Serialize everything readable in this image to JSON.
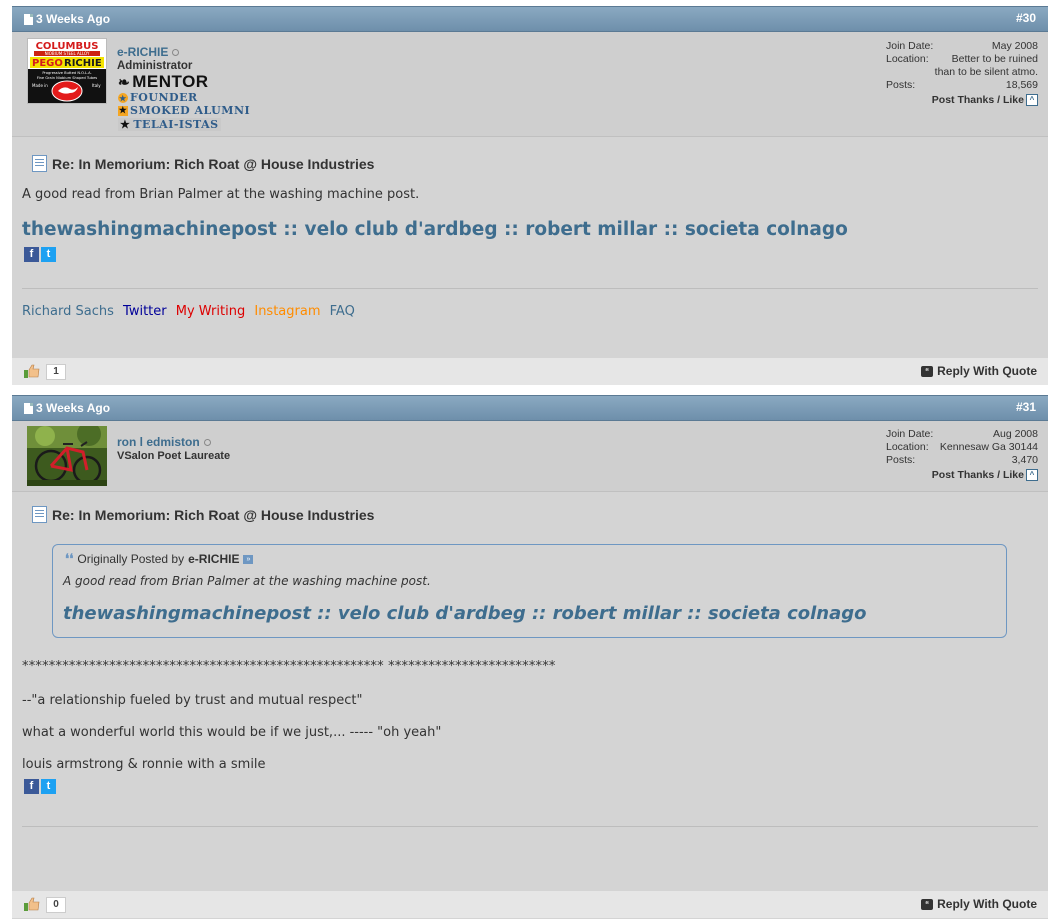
{
  "posts": [
    {
      "date": "3 Weeks Ago",
      "number": "#30",
      "user": {
        "name": "e-RICHIE",
        "title": "Administrator",
        "ranks": [
          "MENTOR",
          "FOUNDER",
          "SMOKED ALUMNI",
          "TELAI-ISTAS"
        ]
      },
      "meta": {
        "join_label": "Join Date:",
        "join_value": "May 2008",
        "location_label": "Location:",
        "location_value": "Better to be ruined",
        "location_value2": "than to be silent atmo.",
        "posts_label": "Posts:",
        "posts_value": "18,569",
        "thanks": "Post Thanks / Like"
      },
      "title": "Re: In Memorium: Rich Roat @ House Industries",
      "lines": [
        "A good read from Brian Palmer at the washing machine post."
      ],
      "big_link": "thewashingmachinepost :: velo club d'ardbeg :: robert millar :: societa colnago",
      "signature": [
        {
          "text": "Richard Sachs",
          "color": "#3e6d8e"
        },
        {
          "text": "Twitter",
          "color": "#000099"
        },
        {
          "text": "My Writing",
          "color": "#dd0000"
        },
        {
          "text": "Instagram",
          "color": "#ff8c00"
        },
        {
          "text": "FAQ",
          "color": "#3e6d8e"
        }
      ],
      "likes": "1",
      "reply": "Reply With Quote"
    },
    {
      "date": "3 Weeks Ago",
      "number": "#31",
      "user": {
        "name": "ron l edmiston",
        "title": "VSalon Poet Laureate"
      },
      "meta": {
        "join_label": "Join Date:",
        "join_value": "Aug 2008",
        "location_label": "Location:",
        "location_value": "Kennesaw Ga 30144",
        "posts_label": "Posts:",
        "posts_value": "3,470",
        "thanks": "Post Thanks / Like"
      },
      "title": "Re: In Memorium: Rich Roat @ House Industries",
      "quote": {
        "prefix": "Originally Posted by",
        "author": "e-RICHIE",
        "text": "A good read from Brian Palmer at the washing machine post.",
        "link": "thewashingmachinepost :: velo club d'ardbeg :: robert millar :: societa colnago"
      },
      "lines": [
        "****************************************************** *************************",
        "--\"a relationship fueled by trust and mutual respect\"",
        "what a wonderful world this would be if we just,... ----- \"oh yeah\"",
        "louis armstrong & ronnie with a smile"
      ],
      "likes": "0",
      "reply": "Reply With Quote"
    }
  ],
  "colors": {
    "accent": "#3e6d8e",
    "header": "#7b9bb5",
    "post_bg": "#d4d4d4"
  },
  "avatar_logo": {
    "line1": "COLUMBUS",
    "line2": "NIOBIUM STEEL ALLOY",
    "line3": "PEGO",
    "line4": "RICHIE",
    "line5": "Progressive Butted N.O.L.A.",
    "line6": "Fine Grain Niobium Shaped Tubes",
    "line7": "Made in",
    "line8": "Italy"
  }
}
